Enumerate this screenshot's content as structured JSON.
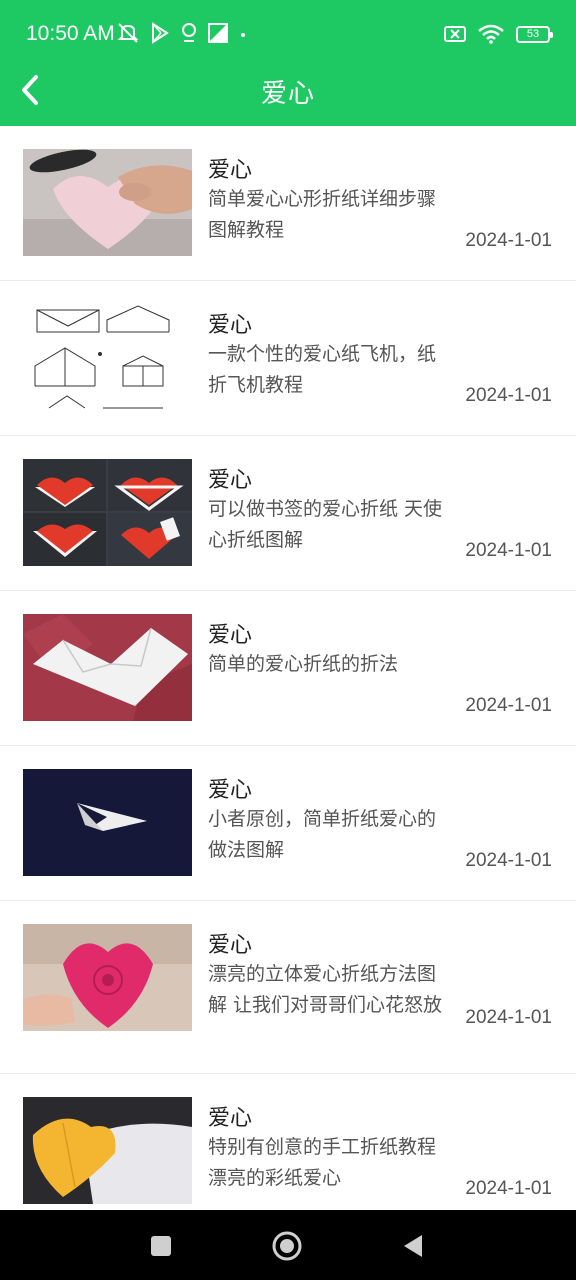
{
  "status": {
    "time": "10:50 AM",
    "battery": "53",
    "icons_left": [
      "mute-icon",
      "play-store-icon",
      "location-icon",
      "gallery-icon",
      "dot-icon"
    ],
    "icons_right": [
      "sim-off-icon",
      "wifi-icon",
      "battery-icon"
    ]
  },
  "header": {
    "title": "爱心",
    "back_icon": "chevron-left-icon",
    "bg_color": "#1ec964"
  },
  "items": [
    {
      "title": "爱心",
      "desc": "简单爱心心形折纸详细步骤图解教程",
      "date": "2024-1-01"
    },
    {
      "title": "爱心",
      "desc": "一款个性的爱心纸飞机，纸折飞机教程",
      "date": "2024-1-01"
    },
    {
      "title": "爱心",
      "desc": "可以做书签的爱心折纸 天使心折纸图解",
      "date": "2024-1-01"
    },
    {
      "title": "爱心",
      "desc": "简单的爱心折纸的折法",
      "date": "2024-1-01"
    },
    {
      "title": "爱心",
      "desc": "小者原创，简单折纸爱心的做法图解",
      "date": "2024-1-01"
    },
    {
      "title": "爱心",
      "desc": "漂亮的立体爱心折纸方法图解 让我们对哥哥们心花怒放",
      "date": "2024-1-01"
    },
    {
      "title": "爱心",
      "desc": "特别有创意的手工折纸教程 漂亮的彩纸爱心",
      "date": "2024-1-01"
    }
  ],
  "navbar": {
    "icons": [
      "recents-square-icon",
      "home-circle-icon",
      "back-triangle-icon"
    ]
  }
}
